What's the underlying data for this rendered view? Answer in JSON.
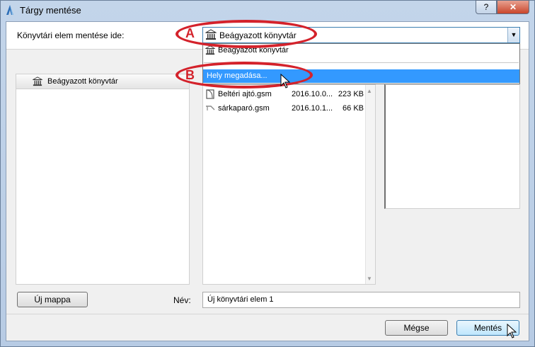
{
  "window": {
    "title": "Tárgy mentése",
    "help_label": "?",
    "close_label": "✕"
  },
  "save_to": {
    "label": "Könyvtári elem mentése ide:",
    "selected": "Beágyazott könyvtár"
  },
  "dropdown": {
    "items": [
      {
        "label": "Beágyazott könyvtár",
        "icon": "library-icon"
      },
      {
        "label": "Hely megadása...",
        "highlighted": true
      }
    ]
  },
  "annotations": {
    "a": "A",
    "b": "B",
    "color": "#d4222b"
  },
  "left_panel": {
    "items": [
      {
        "label": "Beágyazott könyvtár",
        "icon": "library-icon"
      }
    ]
  },
  "files": [
    {
      "name": "Beltéri ajtó.gsm",
      "date": "2016.10.0...",
      "size": "223 KB",
      "icon": "door-icon"
    },
    {
      "name": "sárkaparó.gsm",
      "date": "2016.10.1...",
      "size": "66 KB",
      "icon": "object-icon"
    }
  ],
  "buttons": {
    "new_folder": "Új mappa",
    "cancel": "Mégse",
    "save": "Mentés"
  },
  "name_field": {
    "label": "Név:",
    "value": "Új könyvtári elem 1"
  },
  "colors": {
    "highlight": "#3399ff",
    "window_frame": "#c3d5ea"
  }
}
